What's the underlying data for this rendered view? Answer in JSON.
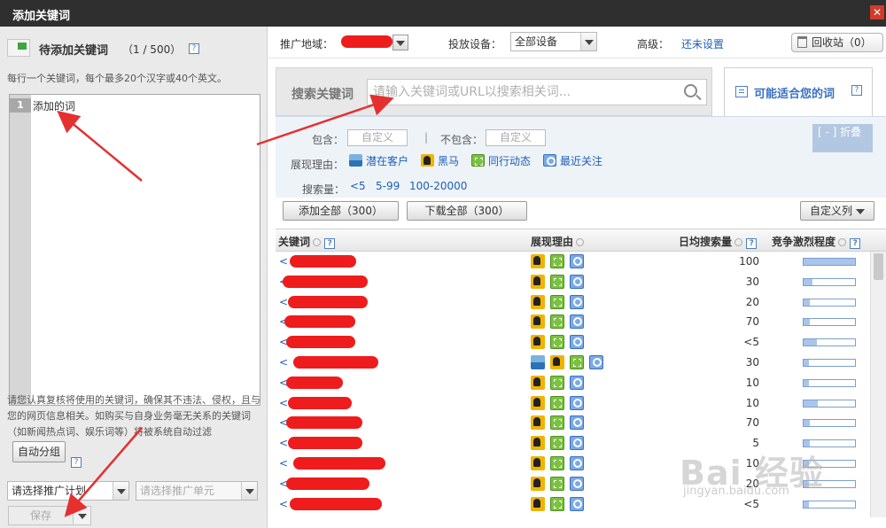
{
  "window": {
    "title": "添加关键词",
    "close_glyph": "✕"
  },
  "left": {
    "header_title": "待添加关键词",
    "header_count": "（1 / 500）",
    "help_glyph": "?",
    "tip_line": "每行一个关键词，每个最多20个汉字或40个英文。",
    "editor": {
      "line_number": "1",
      "line_text": "添加的词"
    },
    "policy_text": "请您认真复核将使用的关键词，确保其不违法、侵权，且与您的网页信息相关。如购买与自身业务毫无关系的关键词（如新闻热点词、娱乐词等）将被系统自动过滤",
    "auto_group_label": "自动分组",
    "plan_select": "请选择推广计划",
    "unit_select": "请选择推广单元",
    "save_label": "保存"
  },
  "topbar": {
    "region_label": "推广地域：",
    "device_label": "投放设备：",
    "device_value": "全部设备",
    "advanced_label": "高级：",
    "advanced_link": "还未设置",
    "trash_label": "回收站（0）"
  },
  "search": {
    "label": "搜索关键词",
    "placeholder": "请输入关键词或URL以搜索相关词..."
  },
  "suggest_tab": {
    "label": "可能适合您的词"
  },
  "filters": {
    "include_label": "包含：",
    "include_chip": "自定义",
    "separator": "|",
    "exclude_label": "不包含：",
    "exclude_chip": "自定义",
    "reason_label": "展现理由：",
    "reasons": [
      {
        "label": "潜在客户",
        "icon": "wave-icon"
      },
      {
        "label": "黑马",
        "icon": "dark-horse-icon"
      },
      {
        "label": "同行动态",
        "icon": "peer-activity-icon"
      },
      {
        "label": "最近关注",
        "icon": "recent-focus-icon"
      }
    ],
    "volume_label": "搜索量：",
    "volume_options": [
      "<5",
      "5-99",
      "100-20000"
    ],
    "collapse_label": "[ - ] 折叠"
  },
  "actions": {
    "add_all": "添加全部（300）",
    "download_all": "下载全部（300）",
    "custom_columns": "自定义列"
  },
  "table": {
    "headers": [
      "关键词",
      "展现理由",
      "日均搜索量",
      "竞争激烈程度"
    ],
    "rows": [
      {
        "icons": [
          "horse",
          "peer",
          "recent"
        ],
        "volume": "100",
        "competition": 1.0
      },
      {
        "icons": [
          "horse",
          "peer",
          "recent"
        ],
        "volume": "30",
        "competition": 0.18
      },
      {
        "icons": [
          "horse",
          "peer",
          "recent"
        ],
        "volume": "20",
        "competition": 0.12
      },
      {
        "icons": [
          "horse",
          "peer",
          "recent"
        ],
        "volume": "70",
        "competition": 0.12
      },
      {
        "icons": [
          "horse",
          "peer",
          "recent"
        ],
        "volume": "<5",
        "competition": 0.25
      },
      {
        "icons": [
          "wave",
          "horse",
          "peer",
          "recent"
        ],
        "volume": "30",
        "competition": 0.1
      },
      {
        "icons": [
          "horse",
          "peer",
          "recent"
        ],
        "volume": "10",
        "competition": 0.1
      },
      {
        "icons": [
          "horse",
          "peer",
          "recent"
        ],
        "volume": "10",
        "competition": 0.28
      },
      {
        "icons": [
          "horse",
          "peer",
          "recent"
        ],
        "volume": "70",
        "competition": 0.12
      },
      {
        "icons": [
          "horse",
          "peer",
          "recent"
        ],
        "volume": "5",
        "competition": 0.12
      },
      {
        "icons": [
          "horse",
          "peer",
          "recent"
        ],
        "volume": "10",
        "competition": 0.1
      },
      {
        "icons": [
          "horse",
          "peer",
          "recent"
        ],
        "volume": "20",
        "competition": 0.1
      },
      {
        "icons": [
          "horse",
          "peer",
          "recent"
        ],
        "volume": "<5",
        "competition": 0.1
      }
    ]
  },
  "watermark": {
    "brand": "Bai 经验",
    "url": "jingyan.baidu.com"
  },
  "colors": {
    "accent": "#1e5fb8",
    "redaction": "#ee1c1c",
    "annotation_arrow": "#e53030"
  }
}
